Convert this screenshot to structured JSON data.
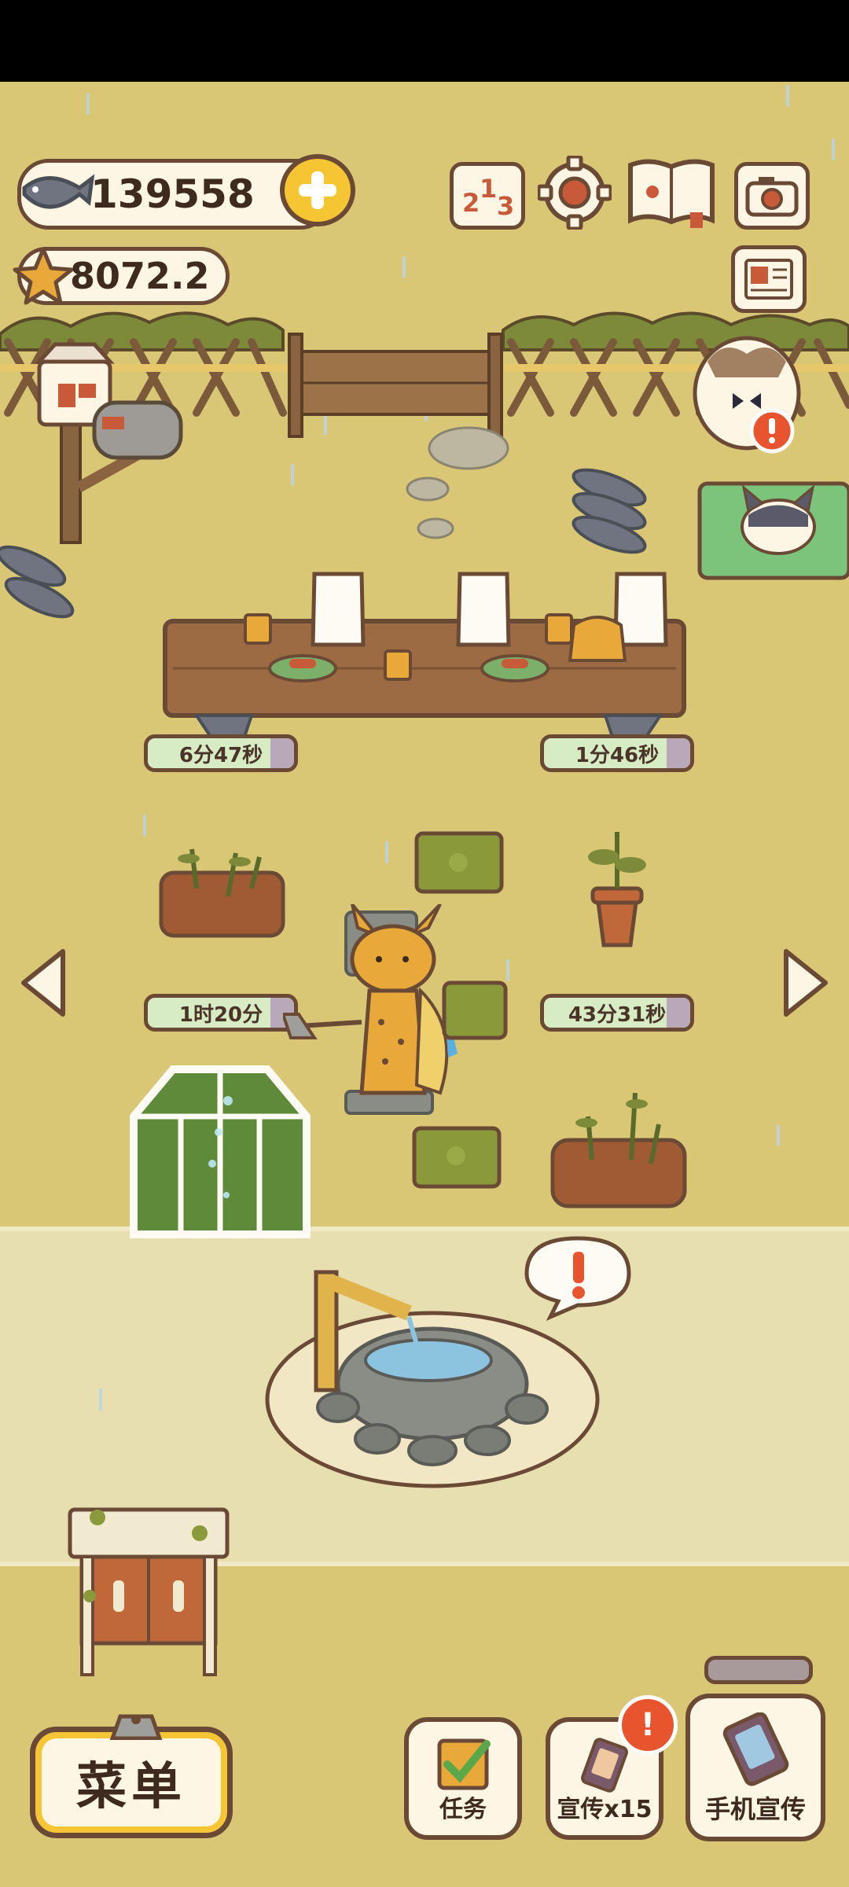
{
  "resources": {
    "fish_count": "139558",
    "star_count": "8072.2"
  },
  "top_icons": [
    "ranking-icon",
    "settings-gear-icon",
    "guide-book-icon",
    "camera-icon",
    "newspaper-icon"
  ],
  "timers": {
    "top_left": "6分47秒",
    "top_right": "1分46秒",
    "mid_left": "1时20分",
    "mid_right": "43分31秒"
  },
  "buttons": {
    "menu": "菜单",
    "tasks": "任务",
    "promote": "宣传x15",
    "phone_promote": "手机宣传"
  },
  "colors": {
    "ground": "#d9c776",
    "path": "#e8dfb1",
    "outline": "#6b4a35",
    "accent_yellow": "#f5c534",
    "alert": "#e8542e"
  }
}
